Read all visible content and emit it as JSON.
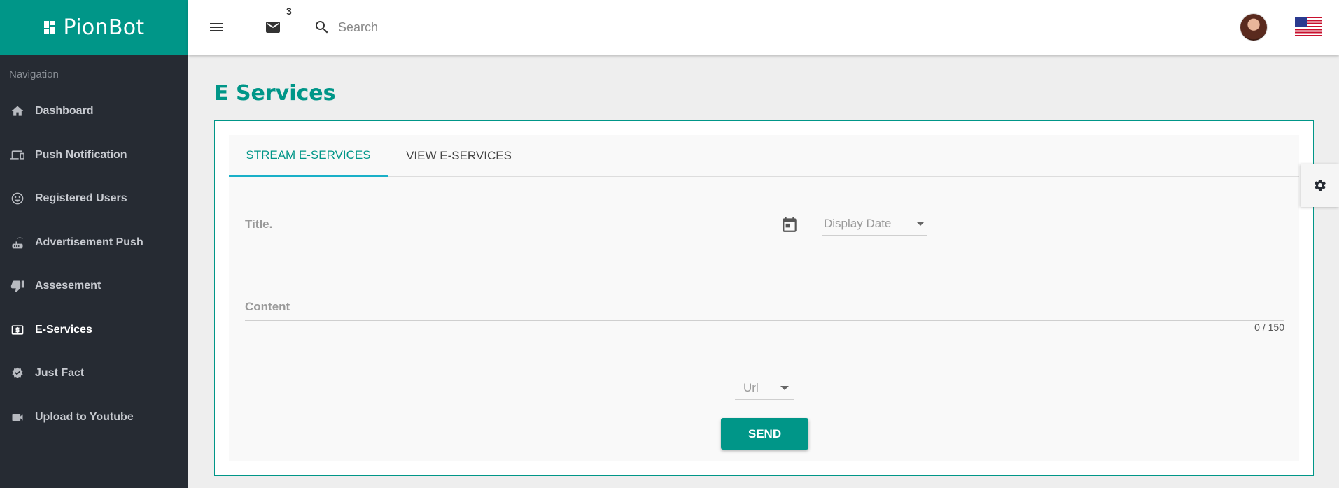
{
  "brand": {
    "name": "PionBot",
    "icon": "dashboard-grid-icon"
  },
  "sidebar": {
    "heading": "Navigation",
    "items": [
      {
        "label": "Dashboard",
        "icon": "home-icon",
        "active": false
      },
      {
        "label": "Push Notification",
        "icon": "devices-icon",
        "active": false
      },
      {
        "label": "Registered Users",
        "icon": "smiley-icon",
        "active": false
      },
      {
        "label": "Advertisement Push",
        "icon": "router-icon",
        "active": false
      },
      {
        "label": "Assesement",
        "icon": "thumbs-icon",
        "active": false
      },
      {
        "label": "E-Services",
        "icon": "dollar-box-icon",
        "active": true
      },
      {
        "label": "Just Fact",
        "icon": "badge-icon",
        "active": false
      },
      {
        "label": "Upload to Youtube",
        "icon": "video-camera-icon",
        "active": false
      }
    ]
  },
  "header": {
    "mail_badge": "3",
    "search_placeholder": "Search"
  },
  "page": {
    "title": "E Services",
    "tabs": [
      {
        "label": "STREAM E-SERVICES",
        "active": true
      },
      {
        "label": "VIEW E-SERVICES",
        "active": false
      }
    ],
    "form": {
      "title_placeholder": "Title.",
      "display_date_placeholder": "Display Date",
      "content_placeholder": "Content",
      "counter": "0 / 150",
      "url_placeholder": "Url",
      "send_label": "SEND"
    }
  },
  "colors": {
    "primary": "#009688",
    "sidebar": "#262b33",
    "tab_indicator": "#1ab0c8"
  }
}
